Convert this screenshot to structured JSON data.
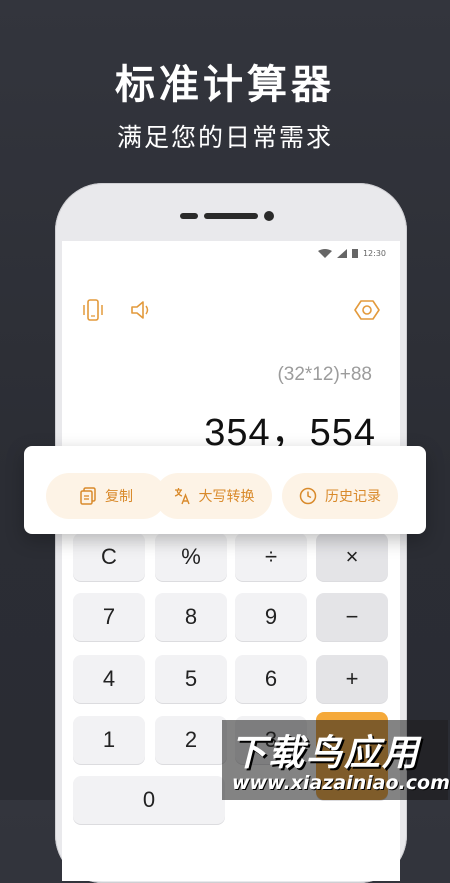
{
  "hero": {
    "title": "标准计算器",
    "subtitle": "满足您的日常需求"
  },
  "statusbar": {
    "time": "12:30"
  },
  "toolbar": {
    "icons": [
      "vibrate-icon",
      "sound-icon",
      "settings-hexagon-icon"
    ]
  },
  "display": {
    "expression": "(32*12)+88",
    "result": "354，554"
  },
  "actions": [
    {
      "label": "复制",
      "icon": "copy-icon"
    },
    {
      "label": "大写转换",
      "icon": "translate-icon"
    },
    {
      "label": "历史记录",
      "icon": "clock-icon"
    }
  ],
  "keys": {
    "row1": [
      "C",
      "%",
      "÷",
      "×"
    ],
    "row2": [
      "7",
      "8",
      "9",
      "−"
    ],
    "row3": [
      "4",
      "5",
      "6",
      "+"
    ],
    "row4": [
      "1",
      "2",
      "3"
    ],
    "row5": [
      "0"
    ]
  },
  "watermark": {
    "title": "下载鸟应用",
    "url": "www.xiazainiao.com"
  },
  "colors": {
    "accent": "#f5a93a",
    "accent_text": "#d98a2b",
    "pill_bg": "#fdf3e6",
    "background": "#2f3138"
  }
}
